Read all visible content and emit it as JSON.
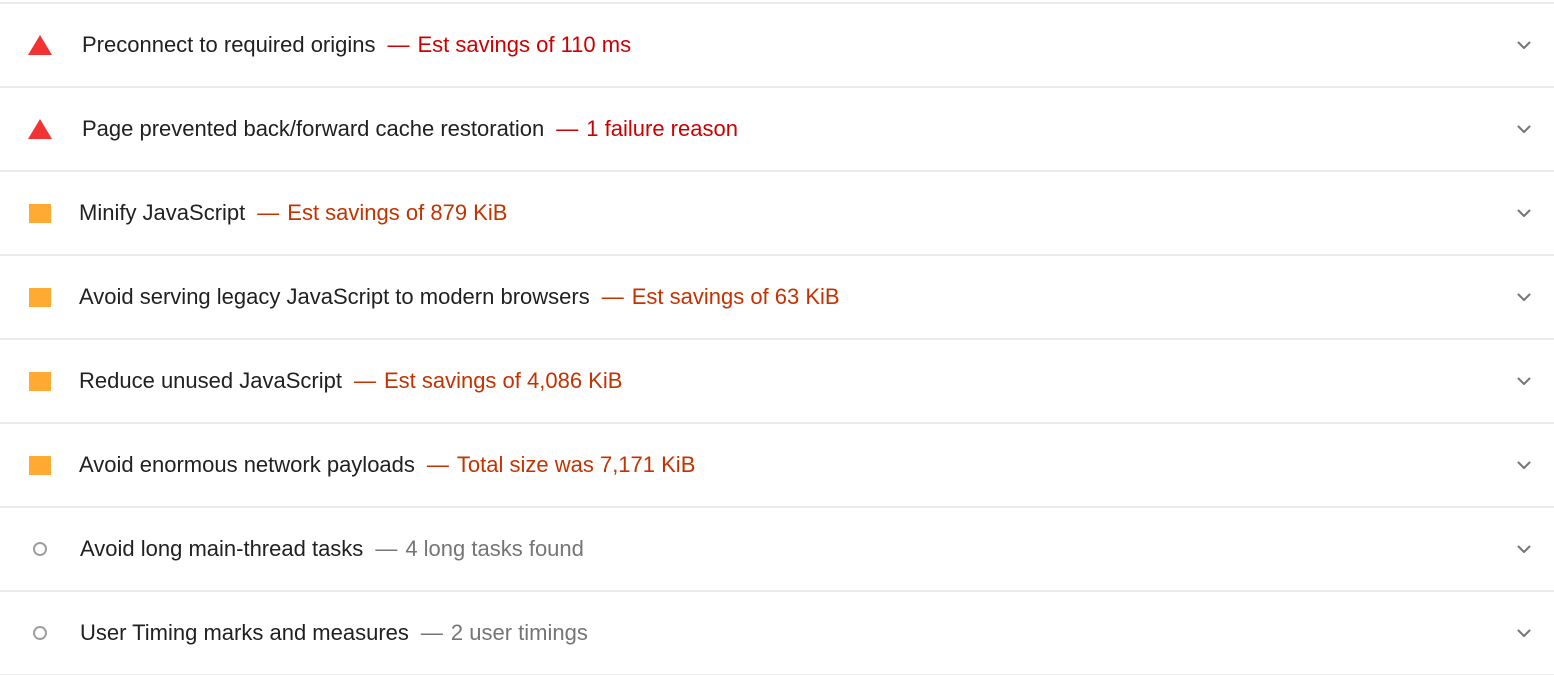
{
  "audits": [
    {
      "title": "Preconnect to required origins",
      "separator": "—",
      "display_value": "Est savings of 110 ms",
      "status": "fail",
      "icon": "fail-triangle-icon",
      "color": "#f33333"
    },
    {
      "title": "Page prevented back/forward cache restoration",
      "separator": "—",
      "display_value": "1 failure reason",
      "status": "fail",
      "icon": "fail-triangle-icon",
      "color": "#f33333"
    },
    {
      "title": "Minify JavaScript",
      "separator": "—",
      "display_value": "Est savings of 879 KiB",
      "status": "average",
      "icon": "average-square-icon",
      "color": "#ffaa33"
    },
    {
      "title": "Avoid serving legacy JavaScript to modern browsers",
      "separator": "—",
      "display_value": "Est savings of 63 KiB",
      "status": "average",
      "icon": "average-square-icon",
      "color": "#ffaa33"
    },
    {
      "title": "Reduce unused JavaScript",
      "separator": "—",
      "display_value": "Est savings of 4,086 KiB",
      "status": "average",
      "icon": "average-square-icon",
      "color": "#ffaa33"
    },
    {
      "title": "Avoid enormous network payloads",
      "separator": "—",
      "display_value": "Total size was 7,171 KiB",
      "status": "average",
      "icon": "average-square-icon",
      "color": "#ffaa33"
    },
    {
      "title": "Avoid long main-thread tasks",
      "separator": "—",
      "display_value": "4 long tasks found",
      "status": "informative",
      "icon": "informative-circle-icon",
      "color": "#9e9e9e"
    },
    {
      "title": "User Timing marks and measures",
      "separator": "—",
      "display_value": "2 user timings",
      "status": "informative",
      "icon": "informative-circle-icon",
      "color": "#9e9e9e"
    }
  ],
  "chevron_icon": "chevron-down-icon",
  "colors": {
    "fail_text": "#cc0000",
    "average_text": "#c33300",
    "informative_text": "#757575",
    "divider": "#ebebeb"
  }
}
